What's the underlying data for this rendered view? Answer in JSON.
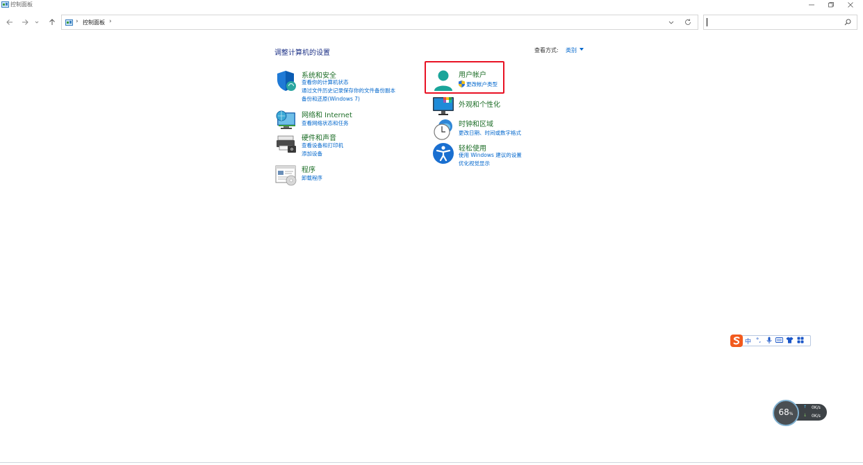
{
  "window": {
    "title": "控制面板"
  },
  "nav": {
    "breadcrumb": "控制面板",
    "search_value": "",
    "search_placeholder": ""
  },
  "main": {
    "heading": "调整计算机的设置",
    "view_by_label": "查看方式:",
    "view_by_value": "类别"
  },
  "categories": {
    "security": {
      "title": "系统和安全",
      "links": [
        "查看你的计算机状态",
        "通过文件历史记录保存你的文件备份副本",
        "备份和还原(Windows 7)"
      ]
    },
    "network": {
      "title": "网络和 Internet",
      "links": [
        "查看网络状态和任务"
      ]
    },
    "hardware": {
      "title": "硬件和声音",
      "links": [
        "查看设备和打印机",
        "添加设备"
      ]
    },
    "programs": {
      "title": "程序",
      "links": [
        "卸载程序"
      ]
    },
    "user_accounts": {
      "title": "用户帐户",
      "links": [
        "更改帐户类型"
      ]
    },
    "appearance": {
      "title": "外观和个性化",
      "links": []
    },
    "clock": {
      "title": "时钟和区域",
      "links": [
        "更改日期、时间或数字格式"
      ]
    },
    "ease": {
      "title": "轻松使用",
      "links": [
        "使用 Windows 建议的设置",
        "优化视觉显示"
      ]
    }
  },
  "ime": {
    "mode": "中",
    "punct": "°,"
  },
  "net_widget": {
    "percent": "68",
    "percent_unit": "%",
    "upload": "0K/s",
    "download": "0K/s"
  },
  "colors": {
    "category_title": "#1e6e28",
    "link": "#0066cc",
    "heading": "#1e3287",
    "highlight": "#e81123"
  }
}
